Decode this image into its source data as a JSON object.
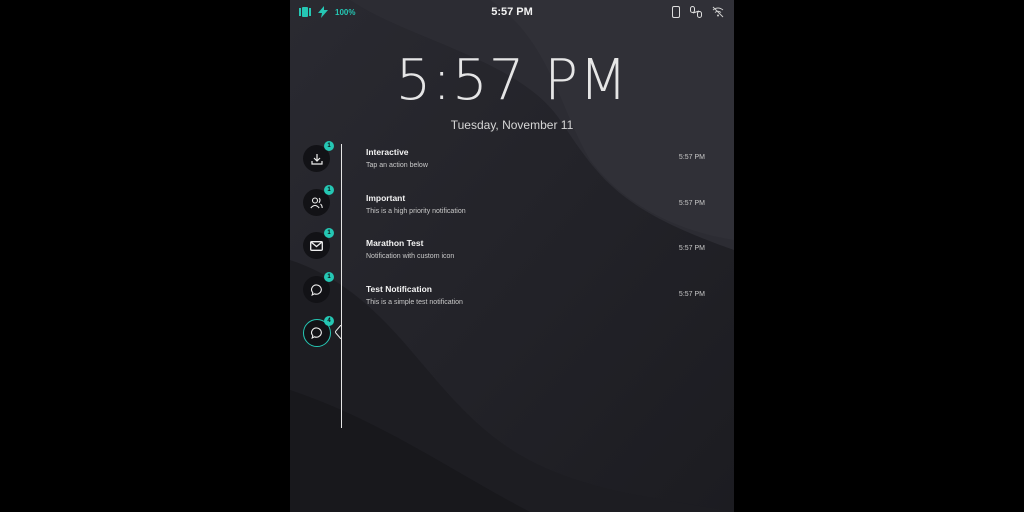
{
  "status_bar": {
    "battery_text": "100%",
    "time": "5:57 PM",
    "accent_color": "#25c7b4"
  },
  "lock_screen": {
    "clock": "5:57 PM",
    "date": "Tuesday, November 11"
  },
  "app_icons": [
    {
      "icon": "download-icon",
      "badge": "1"
    },
    {
      "icon": "users-icon",
      "badge": "1"
    },
    {
      "icon": "mail-icon",
      "badge": "1"
    },
    {
      "icon": "chat-bubble-icon",
      "badge": "1"
    },
    {
      "icon": "chat-bubble-icon",
      "badge": "4",
      "active": true
    }
  ],
  "notifications": [
    {
      "title": "Interactive",
      "subtitle": "Tap an action below",
      "time": "5:57 PM"
    },
    {
      "title": "Important",
      "subtitle": "This is a high priority notification",
      "time": "5:57 PM"
    },
    {
      "title": "Marathon Test",
      "subtitle": "Notification with custom icon",
      "time": "5:57 PM"
    },
    {
      "title": "Test Notification",
      "subtitle": "This is a simple test notification",
      "time": "5:57 PM"
    }
  ]
}
